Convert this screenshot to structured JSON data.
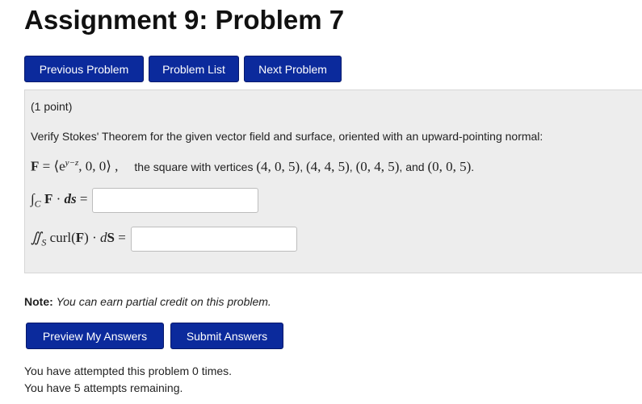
{
  "page": {
    "title": "Assignment 9: Problem 7"
  },
  "nav": {
    "previous": "Previous Problem",
    "list": "Problem List",
    "next": "Next Problem"
  },
  "problem": {
    "points": "(1 point)",
    "instruction": "Verify Stokes' Theorem for the given vector field and surface, oriented with an upward-pointing normal:",
    "field_lhs": "F",
    "field_eq": " = ⟨e",
    "field_exp": "y−z",
    "field_rest": ", 0, 0⟩ ,",
    "surface_text": "the square with vertices",
    "v1": "(4, 0, 5)",
    "v2": "(4, 4, 5)",
    "v3": "(0, 4, 5)",
    "v4": "(0, 0, 5)",
    "comma": ",",
    "and_word": "and",
    "period": ".",
    "line_integral": {
      "symbol": "∫",
      "sub": "C",
      "F": "F",
      "dot": " · ",
      "ds": "ds",
      "equals": " =",
      "value": "",
      "placeholder": ""
    },
    "surface_integral": {
      "symbol": "∬",
      "sub": "S",
      "curl_open": "curl(",
      "F": "F",
      "curl_close": ")",
      "dot": " · ",
      "d": "d",
      "S": "S",
      "equals": " =",
      "value": "",
      "placeholder": ""
    }
  },
  "note": {
    "label": "Note:",
    "text": "You can earn partial credit on this problem."
  },
  "actions": {
    "preview": "Preview My Answers",
    "submit": "Submit Answers"
  },
  "status": {
    "attempted": "You have attempted this problem 0 times.",
    "remaining": "You have 5 attempts remaining."
  },
  "colors": {
    "button_bg": "#0b2a9c",
    "panel_bg": "#ededed"
  }
}
